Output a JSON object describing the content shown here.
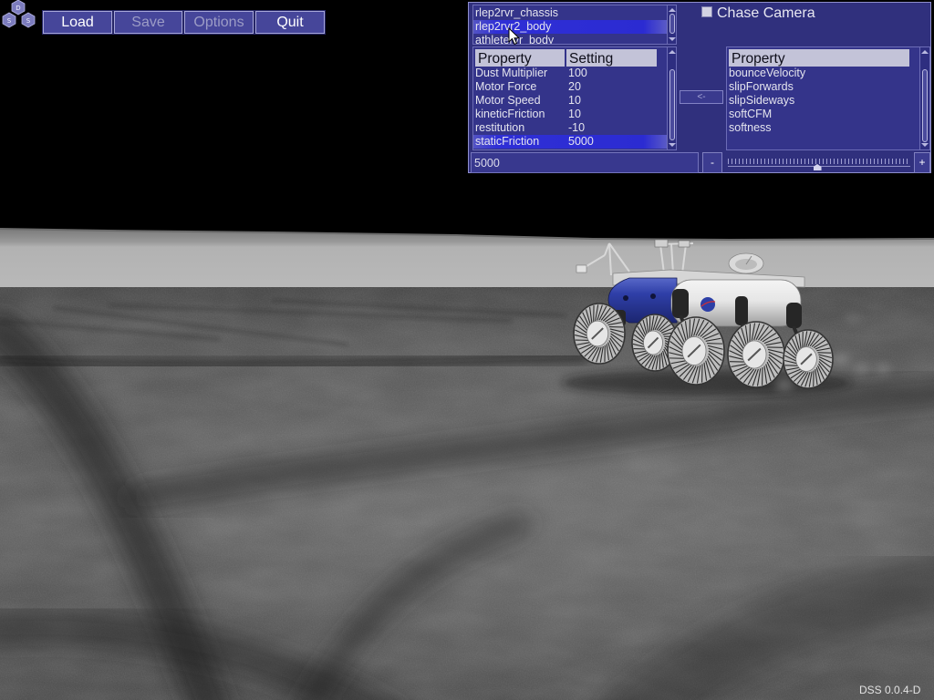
{
  "logo": {
    "top": "D",
    "left": "S",
    "right": "S"
  },
  "toolbar": {
    "load": "Load",
    "save": "Save",
    "options": "Options",
    "quit": "Quit"
  },
  "object_list": {
    "items": [
      "rlep2rvr_chassis",
      "rlep2rvr2_body",
      "athletervr_body"
    ],
    "selected_index": 1
  },
  "chase_camera": {
    "label": "Chase Camera",
    "checked": false
  },
  "property_table": {
    "headers": {
      "property": "Property",
      "setting": "Setting"
    },
    "rows": [
      {
        "property": "Dust Multiplier",
        "setting": "100"
      },
      {
        "property": "Motor Force",
        "setting": "20"
      },
      {
        "property": "Motor Speed",
        "setting": "10"
      },
      {
        "property": "kineticFriction",
        "setting": "10"
      },
      {
        "property": "restitution",
        "setting": "-10"
      },
      {
        "property": "staticFriction",
        "setting": "5000"
      }
    ],
    "selected_index": 5
  },
  "add_property_button": "<-",
  "available_properties": {
    "header": "Property",
    "items": [
      "bounceVelocity",
      "slipForwards",
      "slipSideways",
      "softCFM",
      "softness"
    ]
  },
  "value_editor": {
    "value": "5000",
    "decrement": "-",
    "increment": "+",
    "slider_level": 0.49
  },
  "version": "DSS 0.0.4-D",
  "icons": {
    "logo": "dss-hexagon-logo-icon",
    "cursor": "mouse-pointer-icon",
    "scroll_up": "chevron-up-icon",
    "scroll_down": "chevron-down-icon"
  },
  "colors": {
    "panel": "#323282",
    "button": "#46469a",
    "button_border": "#a6a6d8",
    "selection": "#2e2ed4",
    "header": "#c3c3d8",
    "text": "#e4e4ee",
    "disabled_text": "#9c9cc6",
    "sky": "#000000",
    "ground": "#555555",
    "rover_blue": "#2d3fa6"
  }
}
